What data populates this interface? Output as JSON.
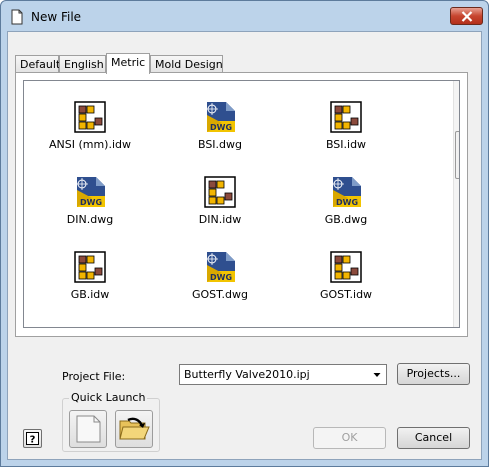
{
  "window": {
    "title": "New File",
    "close_label": "x"
  },
  "tabs": [
    {
      "label": "Default",
      "active": false
    },
    {
      "label": "English",
      "active": false
    },
    {
      "label": "Metric",
      "active": true
    },
    {
      "label": "Mold Design",
      "active": false
    }
  ],
  "templates": [
    {
      "label": "ANSI (mm).idw",
      "icon": "idw-icon"
    },
    {
      "label": "BSI.dwg",
      "icon": "dwg-icon"
    },
    {
      "label": "BSI.idw",
      "icon": "idw-icon"
    },
    {
      "label": "DIN.dwg",
      "icon": "dwg-icon"
    },
    {
      "label": "DIN.idw",
      "icon": "idw-icon"
    },
    {
      "label": "GB.dwg",
      "icon": "dwg-icon"
    },
    {
      "label": "GB.idw",
      "icon": "idw-icon"
    },
    {
      "label": "GOST.dwg",
      "icon": "dwg-icon"
    },
    {
      "label": "GOST.idw",
      "icon": "idw-icon"
    }
  ],
  "project": {
    "label": "Project File:",
    "value": "Butterfly Valve2010.ipj",
    "projects_button": "Projects..."
  },
  "quick_launch": {
    "title": "Quick Launch",
    "buttons": [
      {
        "icon": "new-blank-icon"
      },
      {
        "icon": "open-folder-icon"
      }
    ]
  },
  "buttons": {
    "ok": "OK",
    "cancel": "Cancel",
    "help": "?"
  },
  "colors": {
    "title_bar": "#bcd3ea",
    "close_button": "#c7452f",
    "dwg_yellow": "#f2c400",
    "dwg_blue": "#2f4f8f",
    "idw_cell_brown": "#8b4a3c",
    "idw_cell_yellow": "#f2b500"
  }
}
